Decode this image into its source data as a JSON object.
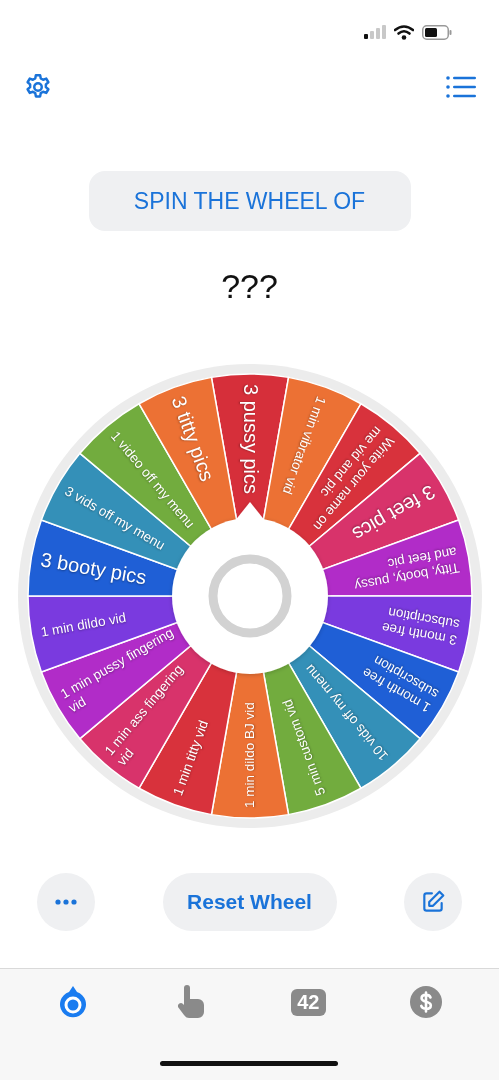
{
  "title_button": "SPIN THE WHEEL OF",
  "result": "???",
  "wheel": {
    "segments": [
      {
        "label": "3 pussy pics",
        "color": "#d62f3a"
      },
      {
        "label": "1 min vibrator vid",
        "color": "#ec7134"
      },
      {
        "label": "Write your name on me vid and pic",
        "color": "#d8323c"
      },
      {
        "label": "3 feet pics",
        "color": "#d8336b"
      },
      {
        "label": "Titty, booty, pussy and feet pic",
        "color": "#b12cc8"
      },
      {
        "label": "3 month free subscription",
        "color": "#7a3adf"
      },
      {
        "label": "1 month free subscription",
        "color": "#1f5fd6"
      },
      {
        "label": "10 vids off my menu",
        "color": "#3490b8"
      },
      {
        "label": "5 min custom vid",
        "color": "#72ac3e"
      },
      {
        "label": "1 min dildo BJ vid",
        "color": "#ec7134"
      },
      {
        "label": "1 min titty vid",
        "color": "#d8323c"
      },
      {
        "label": "1 min ass fingering vid",
        "color": "#d8336b"
      },
      {
        "label": "1 min pussy fingering vid",
        "color": "#b12cc8"
      },
      {
        "label": "1 min dildo vid",
        "color": "#7a3adf"
      },
      {
        "label": "3 booty pics",
        "color": "#1f5fd6"
      },
      {
        "label": "3 vids off my menu",
        "color": "#3490b8"
      },
      {
        "label": "1 video off my menu",
        "color": "#72ac3e"
      },
      {
        "label": "3 titty pics",
        "color": "#ec7134"
      }
    ]
  },
  "reset_button": "Reset Wheel",
  "tabs": [
    {
      "kind": "wheel",
      "selected": true
    },
    {
      "kind": "tap",
      "selected": false
    },
    {
      "kind": "count",
      "label": "42",
      "selected": false
    },
    {
      "kind": "money",
      "selected": false
    }
  ]
}
